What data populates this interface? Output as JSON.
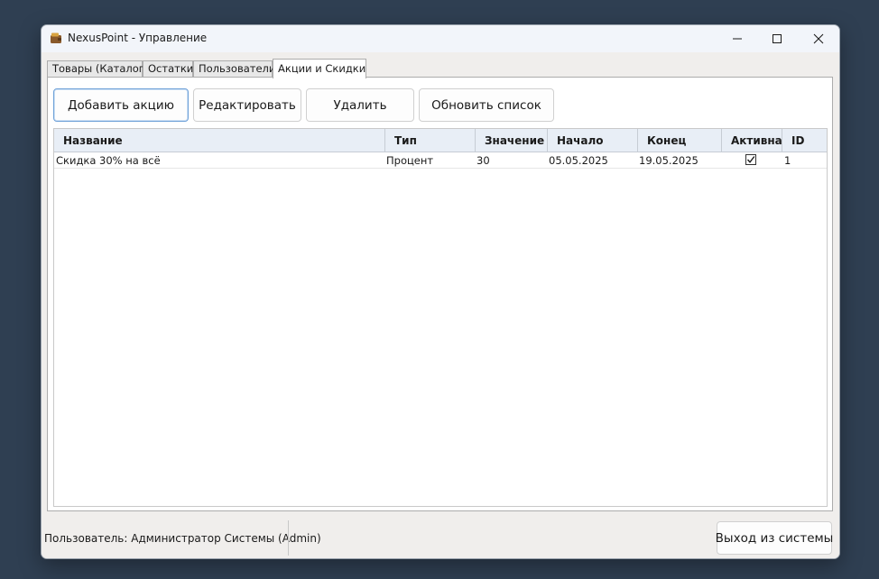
{
  "window": {
    "title": "NexusPoint - Управление",
    "app_icon": "wallet-icon",
    "controls": {
      "minimize": "minimize-icon",
      "maximize": "maximize-icon",
      "close": "close-icon"
    }
  },
  "tabs": [
    {
      "label": "Товары (Каталог)",
      "active": false
    },
    {
      "label": "Остатки",
      "active": false
    },
    {
      "label": "Пользователи",
      "active": false
    },
    {
      "label": "Акции и Скидки",
      "active": true
    }
  ],
  "toolbar": {
    "add_label": "Добавить акцию",
    "edit_label": "Редактировать",
    "delete_label": "Удалить",
    "refresh_label": "Обновить список"
  },
  "grid": {
    "columns": [
      "Название",
      "Тип",
      "Значение",
      "Начало",
      "Конец",
      "Активна",
      "ID"
    ],
    "rows": [
      {
        "name": "Скидка 30% на всё",
        "type": "Процент",
        "value": "30",
        "start": "05.05.2025",
        "end": "19.05.2025",
        "active": true,
        "id": "1"
      }
    ]
  },
  "status": {
    "user_text": "Пользователь: Администратор Системы (Admin)",
    "logout_label": "Выход из системы"
  },
  "colors": {
    "desktop": "#2f3f52",
    "header_bg": "#e8eef6",
    "focus_border": "#6ea1d8"
  }
}
